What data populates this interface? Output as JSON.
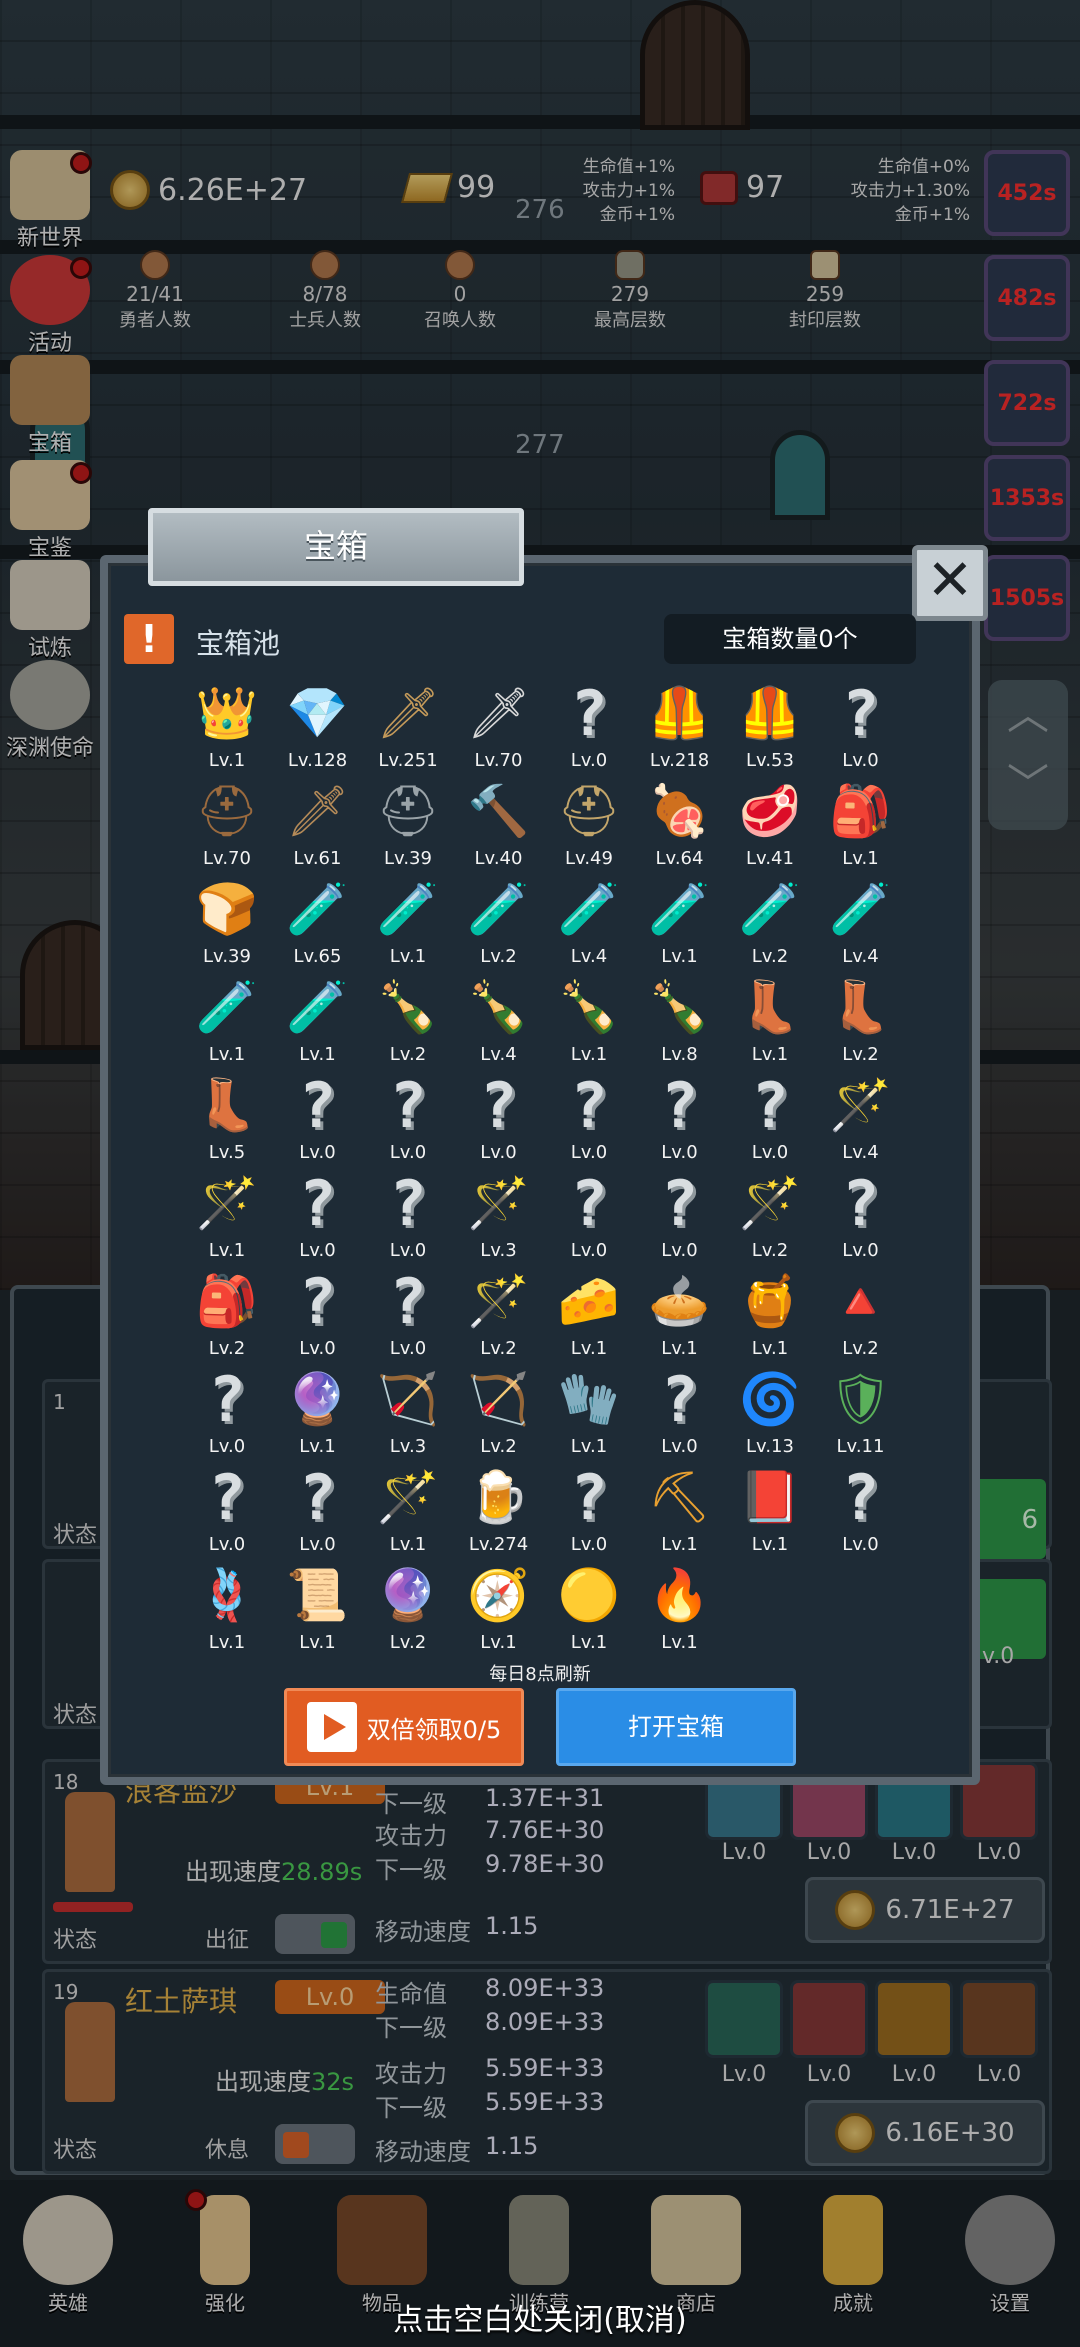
{
  "top": {
    "gold": "6.26E+27",
    "gold_bar": "99",
    "gem": "97",
    "floor_current": "276",
    "floor_next": "277",
    "bonus_left": [
      "生命值+1%",
      "攻击力+1%",
      "金币+1%"
    ],
    "bonus_right": [
      "生命值+0%",
      "攻击力+1.30%",
      "金币+1%"
    ],
    "stats": [
      {
        "value": "21/41",
        "label": "勇者人数"
      },
      {
        "value": "8/78",
        "label": "士兵人数"
      },
      {
        "value": "0",
        "label": "召唤人数"
      },
      {
        "value": "279",
        "label": "最高层数"
      },
      {
        "value": "259",
        "label": "封印层数"
      }
    ]
  },
  "left_menu": [
    "新世界",
    "活动",
    "宝箱",
    "宝鉴",
    "试炼",
    "深渊使命"
  ],
  "right_timers": [
    "452s",
    "482s",
    "722s",
    "1353s",
    "1505s"
  ],
  "modal": {
    "title": "宝箱",
    "pool_label": "宝箱池",
    "chest_count": "宝箱数量0个",
    "refresh_note": "每日8点刷新",
    "double_button": "双倍领取0/5",
    "open_button": "打开宝箱",
    "items": [
      {
        "icon": "👑",
        "lv": "Lv.1",
        "color": "#f1b43a"
      },
      {
        "icon": "💎",
        "lv": "Lv.128",
        "color": "#cfe3ea"
      },
      {
        "icon": "🗡",
        "lv": "Lv.251",
        "color": "#c49a5a"
      },
      {
        "icon": "🗡",
        "lv": "Lv.70",
        "color": "#d8d8d8"
      },
      {
        "icon": "?",
        "lv": "Lv.0",
        "color": ""
      },
      {
        "icon": "🦺",
        "lv": "Lv.218",
        "color": "#a2744a"
      },
      {
        "icon": "🦺",
        "lv": "Lv.53",
        "color": "#8c6a44"
      },
      {
        "icon": "?",
        "lv": "Lv.0",
        "color": ""
      },
      {
        "icon": "⛑",
        "lv": "Lv.70",
        "color": "#9a6a3e"
      },
      {
        "icon": "🗡",
        "lv": "Lv.61",
        "color": "#b48a58"
      },
      {
        "icon": "⛑",
        "lv": "Lv.39",
        "color": "#9aa3a8"
      },
      {
        "icon": "🔨",
        "lv": "Lv.40",
        "color": "#b49a70"
      },
      {
        "icon": "⛑",
        "lv": "Lv.49",
        "color": "#c2a56a"
      },
      {
        "icon": "🍖",
        "lv": "Lv.64",
        "color": "#d7a06e"
      },
      {
        "icon": "🥩",
        "lv": "Lv.41",
        "color": "#d97a5a"
      },
      {
        "icon": "🎒",
        "lv": "Lv.1",
        "color": "#3a7ed0"
      },
      {
        "icon": "🍞",
        "lv": "Lv.39",
        "color": "#e8dcc0"
      },
      {
        "icon": "🧪",
        "lv": "Lv.65",
        "color": "#c8e04a"
      },
      {
        "icon": "🧪",
        "lv": "Lv.1",
        "color": "#c8e04a"
      },
      {
        "icon": "🧪",
        "lv": "Lv.2",
        "color": "#c8e04a"
      },
      {
        "icon": "🧪",
        "lv": "Lv.4",
        "color": "#e04a2a"
      },
      {
        "icon": "🧪",
        "lv": "Lv.1",
        "color": "#e04a2a"
      },
      {
        "icon": "🧪",
        "lv": "Lv.2",
        "color": "#e04a2a"
      },
      {
        "icon": "🧪",
        "lv": "Lv.4",
        "color": "#4aa8e0"
      },
      {
        "icon": "🧪",
        "lv": "Lv.1",
        "color": "#3a8ee0"
      },
      {
        "icon": "🧪",
        "lv": "Lv.1",
        "color": "#3a8ee0"
      },
      {
        "icon": "🍾",
        "lv": "Lv.2",
        "color": "#9ab8b0"
      },
      {
        "icon": "🍾",
        "lv": "Lv.4",
        "color": "#9ac8c8"
      },
      {
        "icon": "🍾",
        "lv": "Lv.1",
        "color": "#a8a84a"
      },
      {
        "icon": "🍾",
        "lv": "Lv.8",
        "color": "#d04a4a"
      },
      {
        "icon": "👢",
        "lv": "Lv.1",
        "color": "#6a9a4a"
      },
      {
        "icon": "👢",
        "lv": "Lv.2",
        "color": "#a8784a"
      },
      {
        "icon": "👢",
        "lv": "Lv.5",
        "color": "#b49a7a"
      },
      {
        "icon": "?",
        "lv": "Lv.0",
        "color": ""
      },
      {
        "icon": "?",
        "lv": "Lv.0",
        "color": ""
      },
      {
        "icon": "?",
        "lv": "Lv.0",
        "color": ""
      },
      {
        "icon": "?",
        "lv": "Lv.0",
        "color": ""
      },
      {
        "icon": "?",
        "lv": "Lv.0",
        "color": ""
      },
      {
        "icon": "?",
        "lv": "Lv.0",
        "color": ""
      },
      {
        "icon": "🪄",
        "lv": "Lv.4",
        "color": "#e8a020"
      },
      {
        "icon": "🪄",
        "lv": "Lv.1",
        "color": "#d8a040"
      },
      {
        "icon": "?",
        "lv": "Lv.0",
        "color": ""
      },
      {
        "icon": "?",
        "lv": "Lv.0",
        "color": ""
      },
      {
        "icon": "🪄",
        "lv": "Lv.3",
        "color": "#b48a58"
      },
      {
        "icon": "?",
        "lv": "Lv.0",
        "color": ""
      },
      {
        "icon": "?",
        "lv": "Lv.0",
        "color": ""
      },
      {
        "icon": "🪄",
        "lv": "Lv.2",
        "color": "#5a9ae0"
      },
      {
        "icon": "?",
        "lv": "Lv.0",
        "color": ""
      },
      {
        "icon": "🎒",
        "lv": "Lv.2",
        "color": "#a8784a"
      },
      {
        "icon": "?",
        "lv": "Lv.0",
        "color": ""
      },
      {
        "icon": "?",
        "lv": "Lv.0",
        "color": ""
      },
      {
        "icon": "🪄",
        "lv": "Lv.2",
        "color": "#e0c890"
      },
      {
        "icon": "🧀",
        "lv": "Lv.1",
        "color": "#f0c860"
      },
      {
        "icon": "🥧",
        "lv": "Lv.1",
        "color": "#d8a060"
      },
      {
        "icon": "🍯",
        "lv": "Lv.1",
        "color": "#e8b040"
      },
      {
        "icon": "🔺",
        "lv": "Lv.2",
        "color": "#c03a5a"
      },
      {
        "icon": "?",
        "lv": "Lv.0",
        "color": ""
      },
      {
        "icon": "🔮",
        "lv": "Lv.1",
        "color": "#4a5ad0"
      },
      {
        "icon": "🏹",
        "lv": "Lv.3",
        "color": "#a8845a"
      },
      {
        "icon": "🏹",
        "lv": "Lv.2",
        "color": "#a8784a"
      },
      {
        "icon": "🧤",
        "lv": "Lv.1",
        "color": "#e06a2a"
      },
      {
        "icon": "?",
        "lv": "Lv.0",
        "color": ""
      },
      {
        "icon": "🌀",
        "lv": "Lv.13",
        "color": "#b08ae0"
      },
      {
        "icon": "🛡",
        "lv": "Lv.11",
        "color": "#5ab05a"
      },
      {
        "icon": "?",
        "lv": "Lv.0",
        "color": ""
      },
      {
        "icon": "?",
        "lv": "Lv.0",
        "color": ""
      },
      {
        "icon": "🪄",
        "lv": "Lv.1",
        "color": "#7ac04a"
      },
      {
        "icon": "🍺",
        "lv": "Lv.274",
        "color": "#e8d8b0"
      },
      {
        "icon": "?",
        "lv": "Lv.0",
        "color": ""
      },
      {
        "icon": "⛏",
        "lv": "Lv.1",
        "color": "#e8a030"
      },
      {
        "icon": "📕",
        "lv": "Lv.1",
        "color": "#d03a2a"
      },
      {
        "icon": "?",
        "lv": "Lv.0",
        "color": ""
      },
      {
        "icon": "🪢",
        "lv": "Lv.1",
        "color": "#c8945a"
      },
      {
        "icon": "📜",
        "lv": "Lv.1",
        "color": "#e0402a"
      },
      {
        "icon": "🔮",
        "lv": "Lv.2",
        "color": "#6ac8f0"
      },
      {
        "icon": "🧭",
        "lv": "Lv.1",
        "color": "#3aa0e0"
      },
      {
        "icon": "🟡",
        "lv": "Lv.1",
        "color": "#e8c020"
      },
      {
        "icon": "🔥",
        "lv": "Lv.1",
        "color": "#e86a2a"
      }
    ]
  },
  "heroes": [
    {
      "num": "18",
      "name": "浪客监沙",
      "lv": "Lv.1",
      "speed_label": "出现速度",
      "speed": "28.89s",
      "state_label": "状态",
      "state": "出征",
      "attrs": [
        {
          "label": "下一级",
          "value": "1.37E+31",
          "next": true
        },
        {
          "label": "攻击力",
          "value": "7.76E+30",
          "next": false
        },
        {
          "label": "下一级",
          "value": "9.78E+30",
          "next": true
        },
        {
          "label": "移动速度",
          "value": "1.15",
          "next": false
        }
      ],
      "skills": [
        "Lv.0",
        "Lv.0",
        "Lv.0",
        "Lv.0"
      ],
      "cost": "6.71E+27"
    },
    {
      "num": "19",
      "name": "红土萨琪",
      "lv": "Lv.0",
      "speed_label": "出现速度",
      "speed": "32s",
      "state_label": "状态",
      "state": "休息",
      "attrs": [
        {
          "label": "生命值",
          "value": "8.09E+33",
          "next": false
        },
        {
          "label": "下一级",
          "value": "8.09E+33",
          "next": true
        },
        {
          "label": "攻击力",
          "value": "5.59E+33",
          "next": false
        },
        {
          "label": "下一级",
          "value": "5.59E+33",
          "next": true
        },
        {
          "label": "移动速度",
          "value": "1.15",
          "next": false
        }
      ],
      "skills": [
        "Lv.0",
        "Lv.0",
        "Lv.0",
        "Lv.0"
      ],
      "cost": "6.16E+30"
    }
  ],
  "hidden_rows": {
    "states": [
      "状态",
      "状态"
    ],
    "row1_num": "1",
    "side_value": "6",
    "lv_snippet": "v.0"
  },
  "bottom_nav": [
    "英雄",
    "强化",
    "物品",
    "训练营",
    "商店",
    "成就",
    "设置"
  ],
  "close_hint": "点击空白处关闭(取消)"
}
